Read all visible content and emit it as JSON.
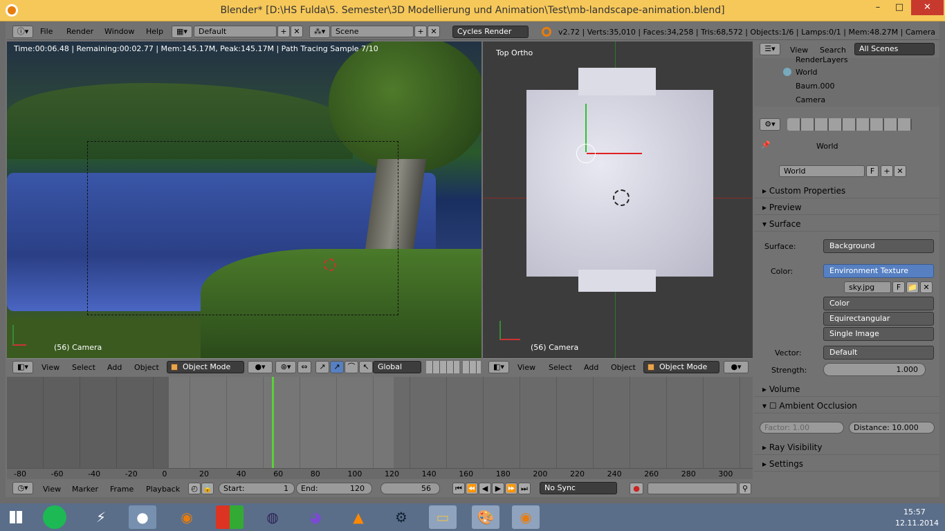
{
  "window": {
    "title": "Blender* [D:\\HS Fulda\\5. Semester\\3D Modellierung und Animation\\Test\\mb-landscape-animation.blend]",
    "minimize": "–",
    "maximize": "□",
    "close": "✕"
  },
  "menubar": {
    "info_icon": "info-icon",
    "items": [
      "File",
      "Render",
      "Window",
      "Help"
    ],
    "layout_value": "Default",
    "scene_value": "Scene",
    "engine_value": "Cycles Render",
    "stats": "v2.72 | Verts:35,010 | Faces:34,258 | Tris:68,572 | Objects:1/6 | Lamps:0/1 | Mem:48.27M | Camera"
  },
  "left_viewport": {
    "render_info": "Time:00:06.48 | Remaining:00:02.77 | Mem:145.17M, Peak:145.17M | Path Tracing Sample 7/10",
    "camera_label": "(56) Camera",
    "menu": [
      "View",
      "Select",
      "Add",
      "Object"
    ],
    "mode": "Object Mode",
    "orientation": "Global"
  },
  "right_viewport": {
    "view_label": "Top Ortho",
    "camera_label": "(56) Camera",
    "menu": [
      "View",
      "Select",
      "Add",
      "Object"
    ],
    "mode": "Object Mode"
  },
  "timeline": {
    "ticks": [
      "-80",
      "-60",
      "-40",
      "-20",
      "0",
      "20",
      "40",
      "60",
      "80",
      "100",
      "120",
      "140",
      "160",
      "180",
      "200",
      "220",
      "240",
      "260",
      "280",
      "300"
    ],
    "menu": [
      "View",
      "Marker",
      "Frame",
      "Playback"
    ],
    "start_label": "Start:",
    "start_value": "1",
    "end_label": "End:",
    "end_value": "120",
    "current_frame": "56",
    "sync": "No Sync"
  },
  "outliner": {
    "menu": [
      "View",
      "Search"
    ],
    "filter": "All Scenes",
    "items": [
      "RenderLayers",
      "World",
      "Baum.000",
      "Camera"
    ]
  },
  "properties": {
    "context": "World",
    "world_name": "World",
    "world_flag": "F",
    "panels": {
      "custom": "Custom Properties",
      "preview": "Preview",
      "surface": "Surface",
      "volume": "Volume",
      "ao": "Ambient Occlusion",
      "ray": "Ray Visibility",
      "settings": "Settings"
    },
    "surface_label": "Surface:",
    "surface_value": "Background",
    "color_label": "Color:",
    "color_value": "Environment Texture",
    "image_name": "sky.jpg",
    "image_flag": "F",
    "color_mode": "Color",
    "projection": "Equirectangular",
    "source": "Single Image",
    "vector_label": "Vector:",
    "vector_value": "Default",
    "strength_label": "Strength:",
    "strength_value": "1.000",
    "factor": "Factor:      1.00",
    "distance": "Distance:  10.000"
  },
  "taskbar": {
    "time": "15:57",
    "date": "12.11.2014"
  },
  "colors": {
    "title_bg": "#f6c85a",
    "close_bg": "#c8392d",
    "select_blue": "#5680c2",
    "frame_marker": "#5bd13a"
  }
}
